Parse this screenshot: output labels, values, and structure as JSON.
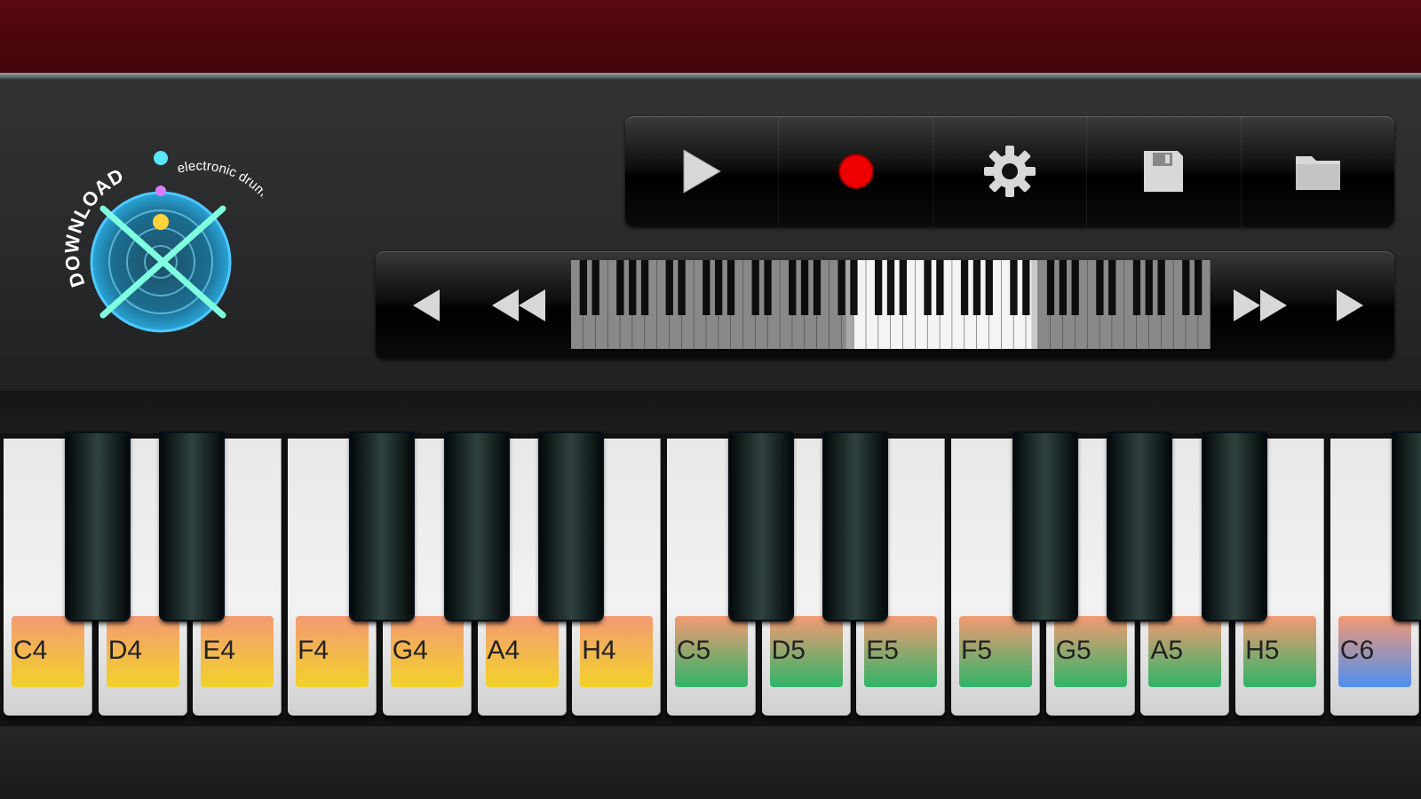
{
  "logo": {
    "line1": "DOWNLOAD",
    "line2": "electronic drums game"
  },
  "toolbar": [
    {
      "name": "play-button",
      "icon": "play-icon"
    },
    {
      "name": "record-button",
      "icon": "record-icon"
    },
    {
      "name": "settings-button",
      "icon": "gear-icon"
    },
    {
      "name": "save-button",
      "icon": "floppy-icon"
    },
    {
      "name": "open-button",
      "icon": "folder-icon"
    }
  ],
  "navigator": {
    "buttons": [
      "step-left-icon",
      "fast-left-icon",
      "fast-right-icon",
      "step-right-icon"
    ],
    "visible_range": {
      "start_fraction": 0.43,
      "end_fraction": 0.72
    }
  },
  "keys": {
    "white": [
      {
        "label": "C4",
        "color_top": "#f39a73",
        "color_bottom": "#f2d22a"
      },
      {
        "label": "D4",
        "color_top": "#f39a73",
        "color_bottom": "#f2d22a"
      },
      {
        "label": "E4",
        "color_top": "#f39a73",
        "color_bottom": "#f2d22a"
      },
      {
        "label": "F4",
        "color_top": "#f39a73",
        "color_bottom": "#f2d22a"
      },
      {
        "label": "G4",
        "color_top": "#f39a73",
        "color_bottom": "#f2d22a"
      },
      {
        "label": "A4",
        "color_top": "#f39a73",
        "color_bottom": "#f2d22a"
      },
      {
        "label": "H4",
        "color_top": "#f39a73",
        "color_bottom": "#f2d22a"
      },
      {
        "label": "C5",
        "color_top": "#f39a73",
        "color_bottom": "#2fb468"
      },
      {
        "label": "D5",
        "color_top": "#f39a73",
        "color_bottom": "#2fb468"
      },
      {
        "label": "E5",
        "color_top": "#f39a73",
        "color_bottom": "#2fb468"
      },
      {
        "label": "F5",
        "color_top": "#f39a73",
        "color_bottom": "#2fb468"
      },
      {
        "label": "G5",
        "color_top": "#f39a73",
        "color_bottom": "#2fb468"
      },
      {
        "label": "A5",
        "color_top": "#f39a73",
        "color_bottom": "#2fb468"
      },
      {
        "label": "H5",
        "color_top": "#f39a73",
        "color_bottom": "#2fb468"
      },
      {
        "label": "C6",
        "color_top": "#f39a73",
        "color_bottom": "#4f8ef0"
      }
    ]
  }
}
